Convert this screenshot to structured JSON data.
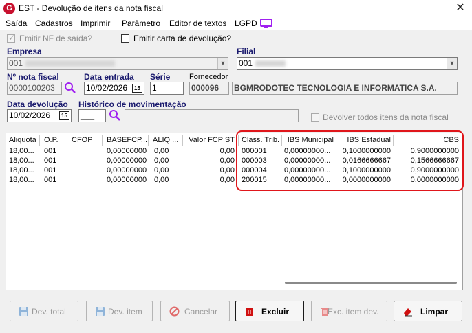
{
  "window": {
    "title": "EST - Devolução de itens da nota fiscal",
    "logo_letter": "G",
    "close_glyph": "✕"
  },
  "menu": {
    "items": [
      "Saída",
      "Cadastros",
      "Imprimir",
      "Parâmetro",
      "Editor de textos",
      "LGPD"
    ]
  },
  "options": {
    "emit_nf_label": "Emitir NF de saída?",
    "emit_nf_checked": true,
    "emit_carta_label": "Emitir carta de devolução?",
    "emit_carta_checked": false
  },
  "empresa": {
    "label": "Empresa",
    "value": "001"
  },
  "filial": {
    "label": "Filial",
    "value": "001"
  },
  "nota": {
    "label": "Nº nota fiscal",
    "value": "0000100203"
  },
  "data_entrada": {
    "label": "Data entrada",
    "value": "10/02/2026"
  },
  "serie": {
    "label": "Série",
    "value": "1"
  },
  "fornecedor": {
    "label": "Fornecedor",
    "code": "000096",
    "name": "BGMRODOTEC TECNOLOGIA E INFORMATICA S.A."
  },
  "data_devolucao": {
    "label": "Data devolução",
    "value": "10/02/2026"
  },
  "historico": {
    "label": "Histórico de movimentação",
    "code": "___",
    "desc": ""
  },
  "devolver_todos": {
    "label": "Devolver todos itens da nota fiscal",
    "checked": false
  },
  "calendar_glyph": "15",
  "table": {
    "columns": [
      "Aliquota",
      "O.P.",
      "CFOP",
      "BASEFCP...",
      "ALIQ ...",
      "Valor FCP ST",
      "Class. Trib.",
      "IBS Municipal",
      "IBS Estadual",
      "CBS"
    ],
    "rows": [
      {
        "aliquota": "18,00...",
        "op": "001",
        "cfop": "",
        "basefcp": "0,00000000",
        "aliq": "0,00",
        "valor_fcp": "0,00",
        "class_trib": "000001",
        "ibs_mun": "0,00000000...",
        "ibs_est": "0,1000000000",
        "cbs": "0,9000000000"
      },
      {
        "aliquota": "18,00...",
        "op": "001",
        "cfop": "",
        "basefcp": "0,00000000",
        "aliq": "0,00",
        "valor_fcp": "0,00",
        "class_trib": "000003",
        "ibs_mun": "0,00000000...",
        "ibs_est": "0,0166666667",
        "cbs": "0,1566666667"
      },
      {
        "aliquota": "18,00...",
        "op": "001",
        "cfop": "",
        "basefcp": "0,00000000",
        "aliq": "0,00",
        "valor_fcp": "0,00",
        "class_trib": "000004",
        "ibs_mun": "0,00000000...",
        "ibs_est": "0,1000000000",
        "cbs": "0,9000000000"
      },
      {
        "aliquota": "18,00...",
        "op": "001",
        "cfop": "",
        "basefcp": "0,00000000",
        "aliq": "0,00",
        "valor_fcp": "0,00",
        "class_trib": "200015",
        "ibs_mun": "0,00000000...",
        "ibs_est": "0,0000000000",
        "cbs": "0,0000000000"
      }
    ]
  },
  "buttons": {
    "dev_total": "Dev. total",
    "dev_item": "Dev. item",
    "cancelar": "Cancelar",
    "excluir": "Excluir",
    "exc_item_dev": "Exc. item dev.",
    "limpar": "Limpar"
  },
  "colors": {
    "label_blue": "#1a1a6e",
    "brand_red": "#c8102e",
    "highlight_red": "#e0161b",
    "search_purple": "#a020f0"
  }
}
